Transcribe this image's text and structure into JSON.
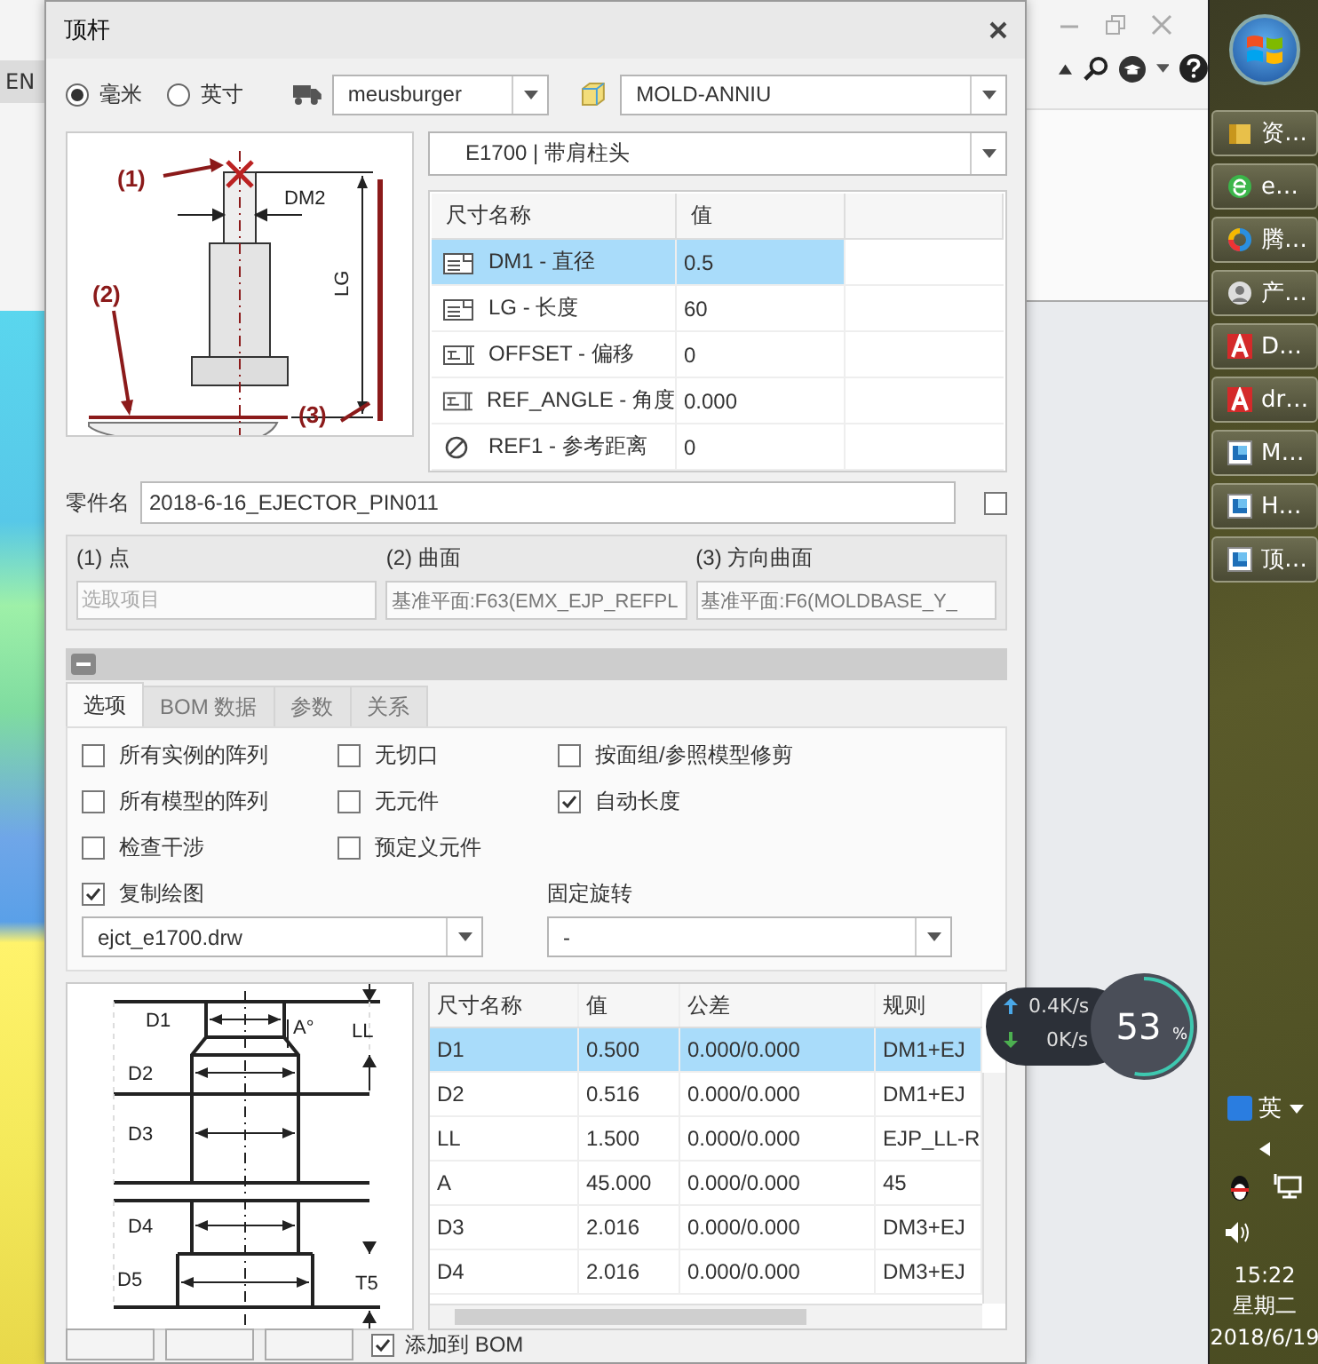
{
  "background_app": {
    "ribbon_label": "EN"
  },
  "dialog": {
    "title": "顶杆",
    "units": [
      {
        "label": "毫米",
        "selected": true
      },
      {
        "label": "英寸",
        "selected": false
      }
    ],
    "supplier": "meusburger",
    "library": "MOLD-ANNIU",
    "pin_diagram": {
      "labels": [
        "(1)",
        "(2)",
        "(3)",
        "DM2",
        "LG"
      ]
    },
    "type": "E1700 | 带肩柱头",
    "params_table": {
      "columns": [
        "尺寸名称",
        "值"
      ],
      "rows": [
        {
          "kind": "dimension",
          "name": "DM1 - 直径",
          "value": "0.5",
          "selected": true
        },
        {
          "kind": "dimension",
          "name": "LG - 长度",
          "value": "60",
          "selected": false
        },
        {
          "kind": "offset",
          "name": "OFFSET - 偏移",
          "value": "0",
          "selected": false
        },
        {
          "kind": "offset",
          "name": "REF_ANGLE - 角度",
          "value": "0.000",
          "selected": false
        },
        {
          "kind": "reference",
          "name": "REF1 - 参考距离",
          "value": "0",
          "selected": false
        }
      ]
    },
    "part_name": {
      "label": "零件名",
      "value": "2018-6-16_EJECTOR_PIN011",
      "checked": false
    },
    "references": [
      {
        "label": "(1) 点",
        "placeholder": "选取项目"
      },
      {
        "label": "(2) 曲面",
        "value": "基准平面:F63(EMX_EJP_REFPL"
      },
      {
        "label": "(3) 方向曲面",
        "value": "基准平面:F6(MOLDBASE_Y_"
      }
    ],
    "tabs": [
      {
        "label": "选项",
        "selected": true
      },
      {
        "label": "BOM 数据",
        "selected": false
      },
      {
        "label": "参数",
        "selected": false
      },
      {
        "label": "关系",
        "selected": false
      }
    ],
    "options": [
      {
        "label": "所有实例的阵列",
        "checked": false
      },
      {
        "label": "无切口",
        "checked": false
      },
      {
        "label": "按面组/参照模型修剪",
        "checked": false
      },
      {
        "label": "所有模型的阵列",
        "checked": false
      },
      {
        "label": "无元件",
        "checked": false
      },
      {
        "label": "自动长度",
        "checked": true
      },
      {
        "label": "检查干涉",
        "checked": false
      },
      {
        "label": "预定义元件",
        "checked": false
      }
    ],
    "copy_drawing": {
      "label": "复制绘图",
      "checked": true,
      "value": "ejct_e1700.drw"
    },
    "fixed_rotation": {
      "label": "固定旋转",
      "value": "-"
    },
    "dims_diagram": {
      "labels": [
        "D1",
        "D2",
        "D3",
        "D4",
        "D5",
        "LL",
        "T5",
        "A°"
      ]
    },
    "dims_table": {
      "columns": [
        "尺寸名称",
        "值",
        "公差",
        "规则"
      ],
      "rows": [
        {
          "name": "D1",
          "value": "0.500",
          "tolerance": "0.000/0.000",
          "rule": "DM1+EJ",
          "selected": true
        },
        {
          "name": "D2",
          "value": "0.516",
          "tolerance": "0.000/0.000",
          "rule": "DM1+EJ",
          "selected": false
        },
        {
          "name": "LL",
          "value": "1.500",
          "tolerance": "0.000/0.000",
          "rule": "EJP_LL-R",
          "selected": false
        },
        {
          "name": "A",
          "value": "45.000",
          "tolerance": "0.000/0.000",
          "rule": "45",
          "selected": false
        },
        {
          "name": "D3",
          "value": "2.016",
          "tolerance": "0.000/0.000",
          "rule": "DM3+EJ",
          "selected": false
        },
        {
          "name": "D4",
          "value": "2.016",
          "tolerance": "0.000/0.000",
          "rule": "DM3+EJ",
          "selected": false
        }
      ]
    },
    "add_to_bom": {
      "label": "添加到 BOM",
      "checked": true
    }
  },
  "net_monitor": {
    "upload": "0.4K/s",
    "download": "0K/s",
    "percent": "53",
    "unit": "%",
    "level": 0.53
  },
  "taskbar": {
    "buttons": [
      {
        "kind": "folder",
        "label": "资…"
      },
      {
        "kind": "browser",
        "label": "e…"
      },
      {
        "kind": "tencent",
        "label": "腾…"
      },
      {
        "kind": "person",
        "label": "产…"
      },
      {
        "kind": "cad",
        "label": "D…"
      },
      {
        "kind": "cad",
        "label": "dr…"
      },
      {
        "kind": "creo",
        "label": "M…"
      },
      {
        "kind": "creo",
        "label": "H…"
      },
      {
        "kind": "creo",
        "label": "顶…"
      }
    ],
    "language": "英",
    "time": "15:22",
    "weekday": "星期二",
    "date": "2018/6/19"
  }
}
